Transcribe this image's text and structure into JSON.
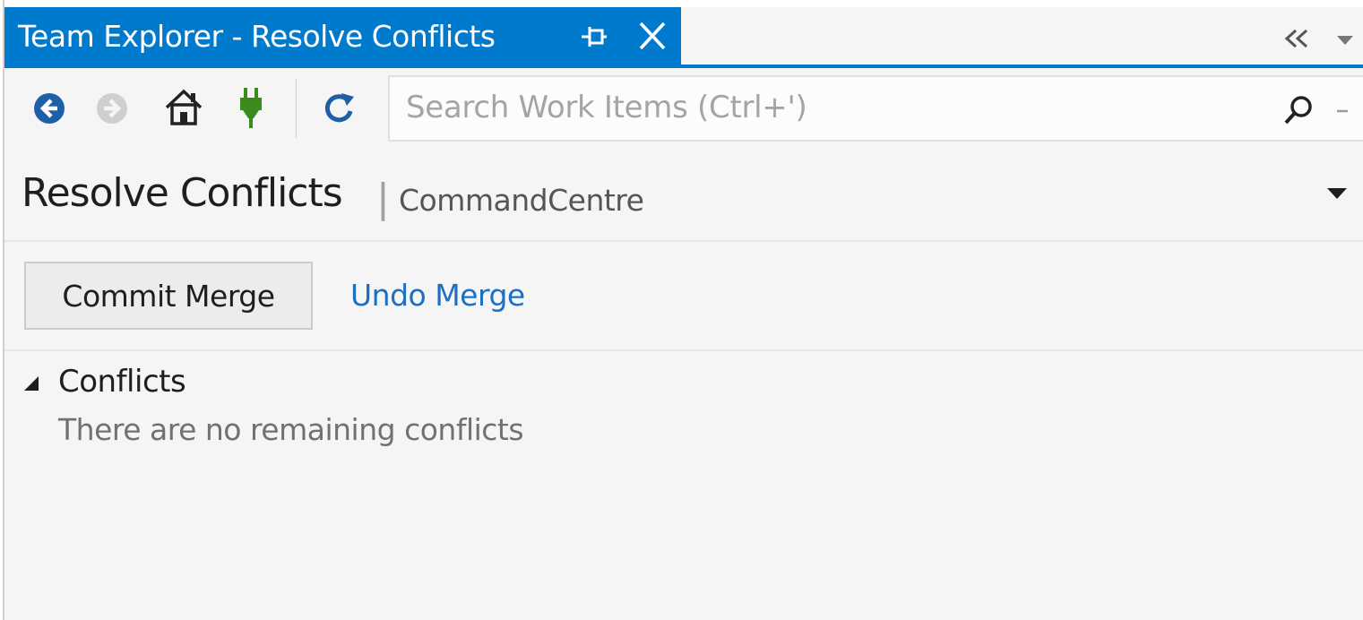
{
  "tab": {
    "title": "Team Explorer - Resolve Conflicts"
  },
  "toolbar": {
    "search_placeholder": "Search Work Items (Ctrl+')",
    "icons": [
      "back-icon",
      "forward-icon",
      "home-icon",
      "connect-icon",
      "refresh-icon",
      "search-icon"
    ]
  },
  "page": {
    "title": "Resolve Conflicts",
    "separator": "|",
    "context": "CommandCentre"
  },
  "actions": {
    "commit_label": "Commit Merge",
    "undo_label": "Undo Merge"
  },
  "conflicts": {
    "title": "Conflicts",
    "message": "There are no remaining conflicts"
  },
  "colors": {
    "accent": "#007acc",
    "link": "#1e6fc2",
    "plug": "#3a8a1e"
  }
}
